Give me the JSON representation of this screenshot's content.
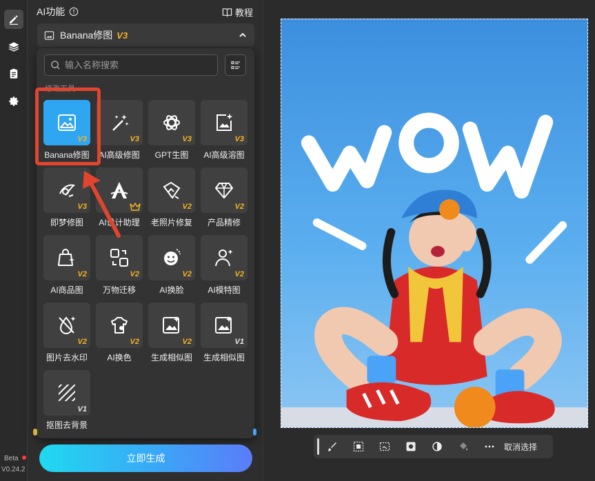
{
  "panel": {
    "title": "AI功能",
    "tutorial_label": "教程",
    "function_name": "Banana修图",
    "function_version": "V3",
    "search_placeholder": "输入名称搜索",
    "section_label": "修改工具"
  },
  "tiles": [
    {
      "label": "Banana修图",
      "version": "V3",
      "icon": "image-edit-icon",
      "selected": true
    },
    {
      "label": "AI高级修图",
      "version": "V3",
      "icon": "magic-wand-icon"
    },
    {
      "label": "GPT生图",
      "version": "V3",
      "icon": "gpt-icon"
    },
    {
      "label": "AI高级溶图",
      "version": "V3",
      "icon": "image-sparkle-icon"
    },
    {
      "label": "即梦修图",
      "version": "V3",
      "icon": "dream-icon"
    },
    {
      "label": "AI设计助理",
      "version": "",
      "icon": "design-assistant-icon",
      "badge": "crown-icon"
    },
    {
      "label": "老照片修复",
      "version": "V2",
      "icon": "photo-repair-icon"
    },
    {
      "label": "产品精修",
      "version": "V2",
      "icon": "diamond-icon"
    },
    {
      "label": "AI商品图",
      "version": "V2",
      "icon": "shopping-bag-icon"
    },
    {
      "label": "万物迁移",
      "version": "V2",
      "icon": "transfer-icon"
    },
    {
      "label": "AI换脸",
      "version": "V2",
      "icon": "face-swap-icon"
    },
    {
      "label": "AI模特图",
      "version": "V2",
      "icon": "model-icon"
    },
    {
      "label": "图片去水印",
      "version": "V2",
      "icon": "watermark-remove-icon"
    },
    {
      "label": "AI换色",
      "version": "V2",
      "icon": "palette-icon"
    },
    {
      "label": "生成相似图",
      "version": "V2",
      "icon": "similar-image-icon"
    },
    {
      "label": "生成相似图",
      "version": "V1",
      "icon": "similar-image-icon"
    },
    {
      "label": "抠图去背景",
      "version": "V1",
      "icon": "remove-background-icon"
    }
  ],
  "generate_button": "立即生成",
  "app": {
    "beta_label": "Beta",
    "version": "V0.24.2"
  },
  "canvas": {
    "image_text": "WOW"
  },
  "toolbar": {
    "items": [
      "brush-icon",
      "smart-select-icon",
      "box-select-icon",
      "mask-icon",
      "invert-icon",
      "fill-icon",
      "more-icon"
    ],
    "cancel_selection": "取消选择"
  },
  "colors": {
    "accent_tile": "#2fa6f2",
    "version_badge": "#f5b324",
    "highlight": "#e0452f",
    "button_gradient": [
      "#20d9f0",
      "#5b7cf8"
    ]
  }
}
